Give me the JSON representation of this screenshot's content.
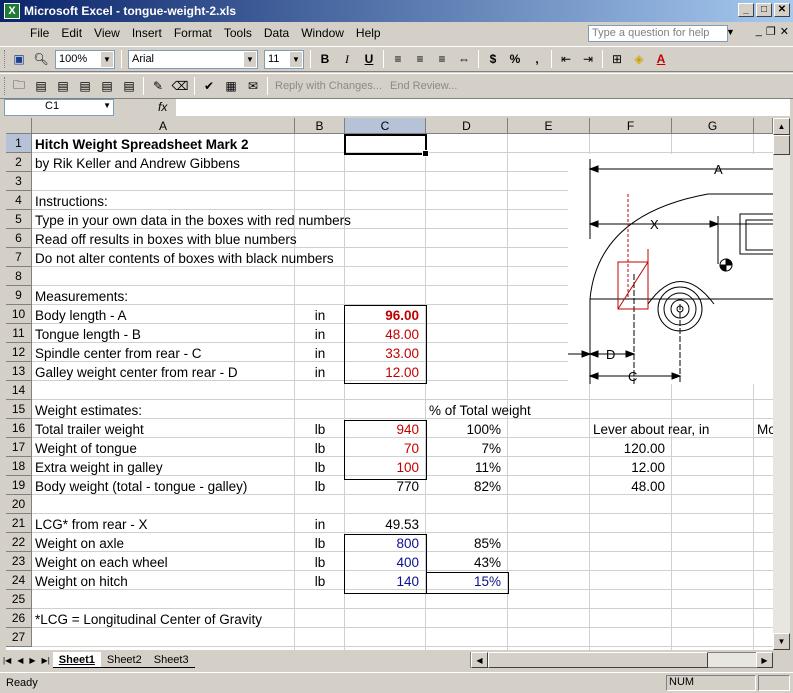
{
  "window": {
    "title": "Microsoft Excel - tongue-weight-2.xls",
    "app_icon": "excel-icon"
  },
  "menu": {
    "items": [
      "File",
      "Edit",
      "View",
      "Insert",
      "Format",
      "Tools",
      "Data",
      "Window",
      "Help"
    ],
    "ask_placeholder": "Type a question for help"
  },
  "toolbar": {
    "zoom": "100%",
    "font": "Arial",
    "size": "11",
    "bold": "B",
    "italic": "I",
    "underline": "U",
    "currency": "$",
    "percent": "%",
    "comma": ","
  },
  "review_toolbar": {
    "reply": "Reply with Changes...",
    "end_review": "End Review..."
  },
  "formula_bar": {
    "name_box": "C1",
    "fx": "fx",
    "content": ""
  },
  "columns": [
    "A",
    "B",
    "C",
    "D",
    "E",
    "F",
    "G"
  ],
  "rows": [
    "1",
    "2",
    "3",
    "4",
    "5",
    "6",
    "7",
    "8",
    "9",
    "10",
    "11",
    "12",
    "13",
    "14",
    "15",
    "16",
    "17",
    "18",
    "19",
    "20",
    "21",
    "22",
    "23",
    "24",
    "25",
    "26",
    "27"
  ],
  "cells": {
    "A1": "Hitch Weight Spreadsheet Mark 2",
    "A2": "by Rik Keller and Andrew Gibbens",
    "A4": "Instructions:",
    "A5": "Type in your own data in the boxes with red numbers",
    "A6": "Read off results in boxes with blue numbers",
    "A7": "Do not alter contents of boxes with black numbers",
    "A9": "Measurements:",
    "A10": "Body length - A",
    "B10": "in",
    "C10": "96.00",
    "A11": "Tongue length - B",
    "B11": "in",
    "C11": "48.00",
    "A12": "Spindle center from rear - C",
    "B12": "in",
    "C12": "33.00",
    "A13": "Galley weight center from rear - D",
    "B13": "in",
    "C13": "12.00",
    "A15": "Weight estimates:",
    "D15": "% of Total weight",
    "A16": "Total trailer weight",
    "B16": "lb",
    "C16": "940",
    "D16": "100%",
    "F16": "Lever about rear, in",
    "H16": "Mo",
    "A17": "Weight of tongue",
    "B17": "lb",
    "C17": "70",
    "D17": "7%",
    "F17": "120.00",
    "A18": "Extra weight in galley",
    "B18": "lb",
    "C18": "100",
    "D18": "11%",
    "F18": "12.00",
    "A19": "Body weight (total - tongue - galley)",
    "B19": "lb",
    "C19": "770",
    "D19": "82%",
    "F19": "48.00",
    "A21": "LCG* from rear - X",
    "B21": "in",
    "C21": "49.53",
    "A22": "Weight on axle",
    "B22": "lb",
    "C22": "800",
    "D22": "85%",
    "A23": "Weight on each wheel",
    "B23": "lb",
    "C23": "400",
    "D23": "43%",
    "A24": "Weight on hitch",
    "B24": "lb",
    "C24": "140",
    "D24": "15%",
    "A26": "*LCG = Longitudinal Center of Gravity"
  },
  "diagram": {
    "label_a": "A",
    "label_x": "X",
    "label_d": "D",
    "label_c": "C"
  },
  "sheets": [
    "Sheet1",
    "Sheet2",
    "Sheet3"
  ],
  "status": {
    "ready": "Ready",
    "num": "NUM"
  },
  "colors": {
    "input_red": "#c00000",
    "output_blue": "#0b0f8c",
    "selection": "#b6c2d8"
  }
}
